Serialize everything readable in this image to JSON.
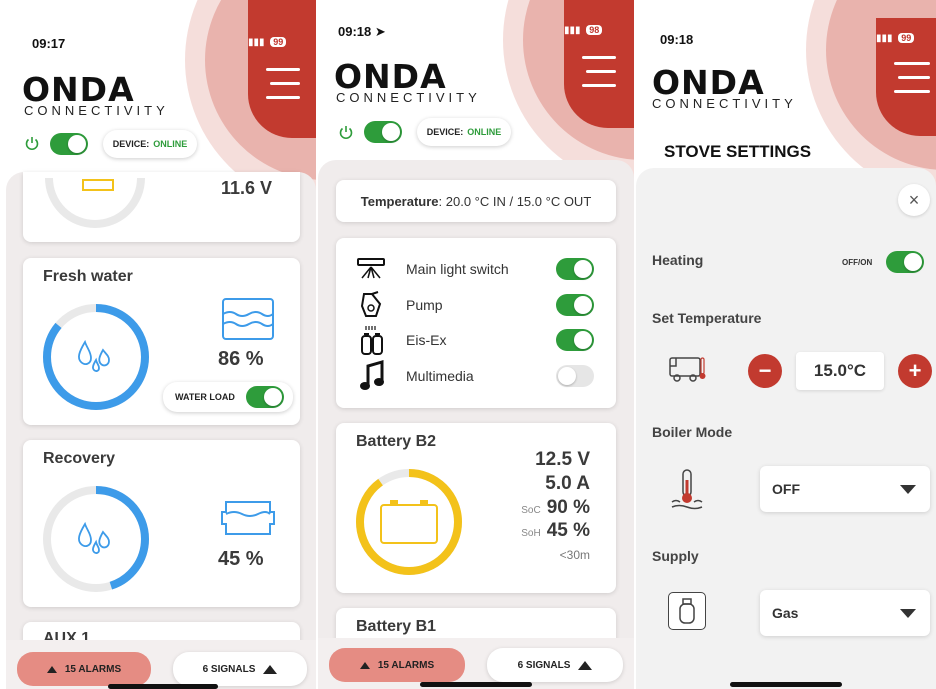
{
  "brand": {
    "name": "ONDA",
    "sub": "CONNECTIVITY"
  },
  "colors": {
    "accent_red": "#c23a2f",
    "green": "#2e9c3b",
    "blue": "#3d9be9",
    "yellow": "#f3c21a",
    "alarm": "#e58c83"
  },
  "screen1": {
    "time": "09:17",
    "battery_level": "99",
    "device_label": "DEVICE:",
    "device_status": "ONLINE",
    "power_toggle_on": true,
    "top_card_value": "11.6 V",
    "fresh_water": {
      "title": "Fresh water",
      "percent": "86 %",
      "level": 0.86,
      "load_label": "WATER LOAD"
    },
    "recovery": {
      "title": "Recovery",
      "percent": "45 %",
      "level": 0.45
    },
    "aux_title": "AUX 1",
    "alarms_label": "15 ALARMS",
    "signals_label": "6 SIGNALS"
  },
  "screen2": {
    "time": "09:18",
    "battery_level": "98",
    "device_label": "DEVICE:",
    "device_status": "ONLINE",
    "temperature_label": "Temperature",
    "temperature_value": ": 20.0 °C IN / 15.0 °C OUT",
    "switches": [
      {
        "label": "Main light switch",
        "icon": "ceiling-light-icon",
        "on": true
      },
      {
        "label": "Pump",
        "icon": "pump-icon",
        "on": true
      },
      {
        "label": "Eis-Ex",
        "icon": "eis-ex-icon",
        "on": true
      },
      {
        "label": "Multimedia",
        "icon": "music-note-icon",
        "on": false
      }
    ],
    "battery_b2": {
      "title": "Battery B2",
      "voltage": "12.5 V",
      "current": "5.0 A",
      "soc_label": "SoC",
      "soc": "90 %",
      "soh_label": "SoH",
      "soh": "45 %",
      "remaining": "<30m",
      "level": 0.9
    },
    "battery_b1_title": "Battery B1",
    "alarms_label": "15 ALARMS",
    "signals_label": "6 SIGNALS"
  },
  "screen3": {
    "time": "09:18",
    "battery_level": "99",
    "page_title": "STOVE SETTINGS",
    "heating_label": "Heating",
    "heating_toggle_label": "OFF/ON",
    "set_temperature_label": "Set Temperature",
    "temperature_value": "15.0°C",
    "boiler_mode_label": "Boiler Mode",
    "boiler_mode_value": "OFF",
    "supply_label": "Supply",
    "supply_value": "Gas"
  }
}
